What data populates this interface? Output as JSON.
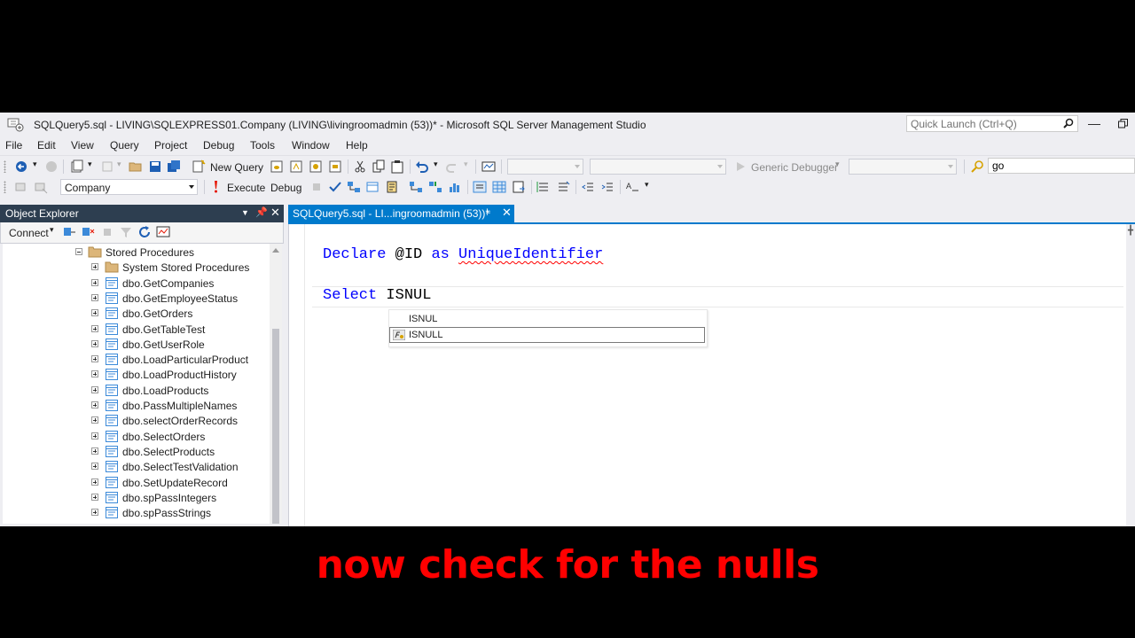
{
  "window": {
    "title": "SQLQuery5.sql - LIVING\\SQLEXPRESS01.Company (LIVING\\livingroomadmin (53))* - Microsoft SQL Server Management Studio",
    "quick_launch_placeholder": "Quick Launch (Ctrl+Q)"
  },
  "menu": [
    "File",
    "Edit",
    "View",
    "Query",
    "Project",
    "Debug",
    "Tools",
    "Window",
    "Help"
  ],
  "toolbar": {
    "new_query": "New Query",
    "debugger": "Generic Debugger",
    "find_value": "go",
    "database": "Company",
    "execute": "Execute",
    "debug": "Debug"
  },
  "object_explorer": {
    "title": "Object Explorer",
    "connect": "Connect",
    "tree": [
      {
        "label": "Stored Procedures",
        "type": "folder",
        "expanded": true
      },
      {
        "label": "System Stored Procedures",
        "type": "folder",
        "expanded": false
      },
      {
        "label": "dbo.GetCompanies",
        "type": "proc"
      },
      {
        "label": "dbo.GetEmployeeStatus",
        "type": "proc"
      },
      {
        "label": "dbo.GetOrders",
        "type": "proc"
      },
      {
        "label": "dbo.GetTableTest",
        "type": "proc"
      },
      {
        "label": "dbo.GetUserRole",
        "type": "proc"
      },
      {
        "label": "dbo.LoadParticularProduct",
        "type": "proc"
      },
      {
        "label": "dbo.LoadProductHistory",
        "type": "proc"
      },
      {
        "label": "dbo.LoadProducts",
        "type": "proc"
      },
      {
        "label": "dbo.PassMultipleNames",
        "type": "proc"
      },
      {
        "label": "dbo.selectOrderRecords",
        "type": "proc"
      },
      {
        "label": "dbo.SelectOrders",
        "type": "proc"
      },
      {
        "label": "dbo.SelectProducts",
        "type": "proc"
      },
      {
        "label": "dbo.SelectTestValidation",
        "type": "proc"
      },
      {
        "label": "dbo.SetUpdateRecord",
        "type": "proc"
      },
      {
        "label": "dbo.spPassIntegers",
        "type": "proc"
      },
      {
        "label": "dbo.spPassStrings",
        "type": "proc"
      }
    ]
  },
  "editor": {
    "tab_label": "SQLQuery5.sql - LI...ingroomadmin (53))*",
    "line1": {
      "kw1": "Declare",
      "var": " @ID ",
      "kw2": "as",
      "type": "UniqueIdentifier"
    },
    "line2": {
      "kw": "Select",
      "text": " ISNUL"
    },
    "autocomplete": {
      "hint": "ISNUL",
      "item": "ISNULL"
    }
  },
  "caption": "now check for the nulls",
  "colors": {
    "accent": "#007acc",
    "panel_title": "#2d3e50",
    "caption": "#ff0000",
    "keyword": "#0000ff"
  }
}
